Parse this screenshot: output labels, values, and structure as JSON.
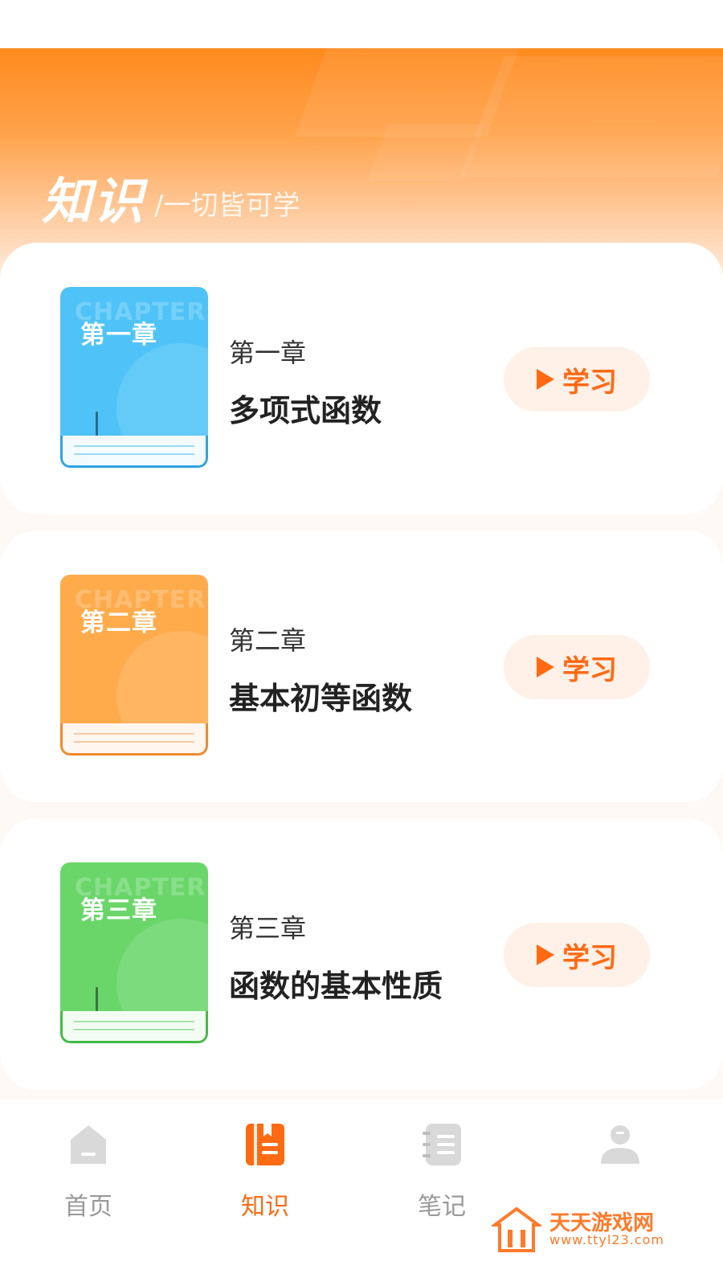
{
  "header": {
    "title": "知识",
    "subtitle": "/一切皆可学"
  },
  "chapters": [
    {
      "book_watermark": "CHAPTER",
      "book_label": "第一章",
      "chapter": "第一章",
      "title": "多项式函数",
      "button_label": "学习",
      "color": "#4fc3f7",
      "accent": "#2ea3e0",
      "pages_line": "#9fd8f4"
    },
    {
      "book_watermark": "CHAPTER",
      "book_label": "第二章",
      "chapter": "第二章",
      "title": "基本初等函数",
      "button_label": "学习",
      "color": "#ffab4c",
      "accent": "#f08a2a",
      "pages_line": "#f6c9a3"
    },
    {
      "book_watermark": "CHAPTER",
      "book_label": "第三章",
      "chapter": "第三章",
      "title": "函数的基本性质",
      "button_label": "学习",
      "color": "#6ad66a",
      "accent": "#44b944",
      "pages_line": "#a6e3a6"
    }
  ],
  "tabbar": {
    "items": [
      {
        "label": "首页",
        "icon": "home-icon",
        "active": false
      },
      {
        "label": "知识",
        "icon": "knowledge-book-icon",
        "active": true
      },
      {
        "label": "笔记",
        "icon": "notebook-icon",
        "active": false
      },
      {
        "label": "",
        "icon": "profile-icon",
        "active": false
      }
    ],
    "active_color": "#ff6a13",
    "inactive_color": "#999999"
  },
  "watermark": {
    "text": "天天游戏网",
    "url": "www.ttyl23.com"
  },
  "colors": {
    "accent": "#ff6a13",
    "hero_top": "#ff8a1e"
  }
}
